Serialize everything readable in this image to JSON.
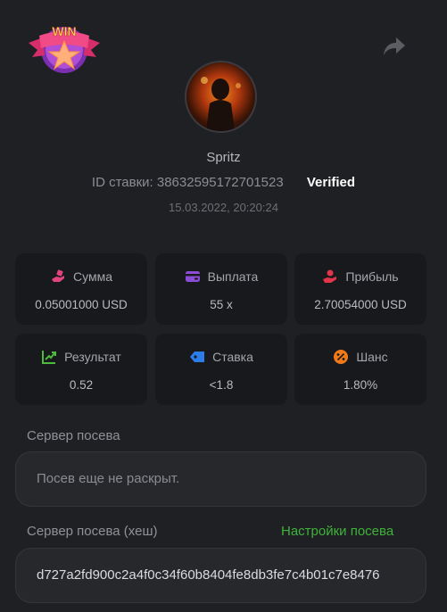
{
  "user": {
    "name": "Spritz",
    "bet_id_label": "ID ставки:",
    "bet_id": "38632595172701523",
    "verified": "Verified",
    "datetime": "15.03.2022, 20:20:24"
  },
  "logo": {
    "text": "WIN"
  },
  "stats": [
    {
      "label": "Сумма",
      "value": "0.05001000 USD",
      "icon": "hand-coins-icon",
      "color": "#e0457b"
    },
    {
      "label": "Выплата",
      "value": "55 x",
      "icon": "wallet-card-icon",
      "color": "#8b4dd6"
    },
    {
      "label": "Прибыль",
      "value": "2.70054000 USD",
      "icon": "profit-hand-icon",
      "color": "#e2344a"
    },
    {
      "label": "Результат",
      "value": "0.52",
      "icon": "chart-up-icon",
      "color": "#4fbb3c"
    },
    {
      "label": "Ставка",
      "value": "<1.8",
      "icon": "bet-tag-icon",
      "color": "#2c7de8"
    },
    {
      "label": "Шанс",
      "value": "1.80%",
      "icon": "percent-icon",
      "color": "#f07a1a"
    }
  ],
  "seed": {
    "server_label": "Сервер посева",
    "server_value": "Посев еще не раскрыт.",
    "hash_label": "Сервер посева (хеш)",
    "settings_link": "Настройки посева",
    "hash_value": "d727a2fd900c2a4f0c34f60b8404fe8db3fe7c4b01c7e8476"
  }
}
